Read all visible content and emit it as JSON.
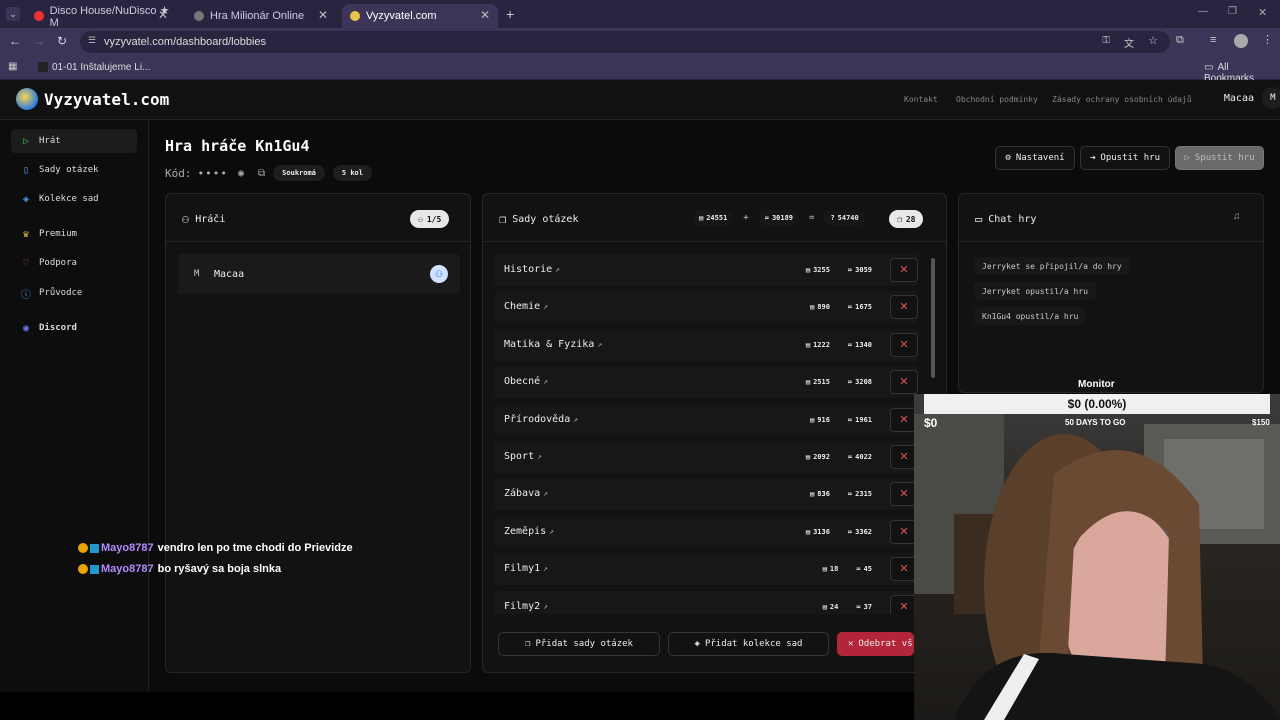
{
  "browser": {
    "tabs": [
      {
        "title": "Disco House/NuDisco ★ M",
        "color": "#e33"
      },
      {
        "title": "Hra Milionár Online",
        "color": "#888"
      },
      {
        "title": "Vyzyvatel.com",
        "color": "#e8c34a"
      }
    ],
    "url": "vyzyvatel.com/dashboard/lobbies",
    "bookmark": "01-01 Inštalujeme Li...",
    "all_bookmarks": "All Bookmarks"
  },
  "site": {
    "logo": "Vyzyvatel.com",
    "nav": [
      "Kontakt",
      "Obchodní podmínky",
      "Zásady ochrany osobních údajů"
    ],
    "user": "Macaa",
    "user_initial": "M"
  },
  "sidebar": {
    "items": [
      {
        "label": "Hrát",
        "icon": "play-icon"
      },
      {
        "label": "Sady otázek",
        "icon": "book-icon"
      },
      {
        "label": "Kolekce sad",
        "icon": "layers-icon"
      },
      {
        "label": "Premium",
        "icon": "crown-icon"
      },
      {
        "label": "Podpora",
        "icon": "heart-icon"
      },
      {
        "label": "Průvodce",
        "icon": "help-icon"
      },
      {
        "label": "Discord",
        "icon": "discord-icon"
      }
    ]
  },
  "game": {
    "title": "Hra hráče Kn1Gu4",
    "code_label": "Kód:",
    "code_value": "••••",
    "privacy": "Soukromá",
    "rounds": "5 kol",
    "settings_btn": "Nastavení",
    "leave_btn": "Opustit hru",
    "start_btn": "Spustit hru"
  },
  "players": {
    "title": "Hráči",
    "count": "1/5",
    "list": [
      {
        "initial": "M",
        "name": "Macaa"
      }
    ]
  },
  "sets": {
    "title": "Sady otázek",
    "total_a": "24551",
    "total_b": "30189",
    "total": "54740",
    "count": "28",
    "items": [
      {
        "name": "Historie",
        "a": "3255",
        "b": "3059"
      },
      {
        "name": "Chemie",
        "a": "890",
        "b": "1675"
      },
      {
        "name": "Matika & Fyzika",
        "a": "1222",
        "b": "1340"
      },
      {
        "name": "Obecné",
        "a": "2515",
        "b": "3208"
      },
      {
        "name": "Přírodověda",
        "a": "916",
        "b": "1961"
      },
      {
        "name": "Sport",
        "a": "2092",
        "b": "4022"
      },
      {
        "name": "Zábava",
        "a": "836",
        "b": "2315"
      },
      {
        "name": "Zeměpis",
        "a": "3136",
        "b": "3362"
      },
      {
        "name": "Filmy1",
        "a": "18",
        "b": "45"
      },
      {
        "name": "Filmy2",
        "a": "24",
        "b": "37"
      }
    ],
    "add_sets_btn": "Přidat sady otázek",
    "add_collection_btn": "Přidat kolekce sad",
    "remove_all_btn": "Odebrat vš"
  },
  "chat": {
    "title": "Chat hry",
    "messages": [
      "Jerryket se připojil/a do hry",
      "Jerryket opustil/a hru",
      "Kn1Gu4 opustil/a hru"
    ]
  },
  "stream": {
    "monitor_label": "Monitor",
    "monitor_value": "$0 (0.00%)",
    "left_amount": "$0",
    "days": "50 DAYS TO GO",
    "goal": "$150",
    "chat": [
      {
        "user": "Mayo8787",
        "text": "vendro len po tme chodi do Prievidze"
      },
      {
        "user": "Mayo8787",
        "text": "bo ryšavý sa boja slnka"
      }
    ]
  }
}
